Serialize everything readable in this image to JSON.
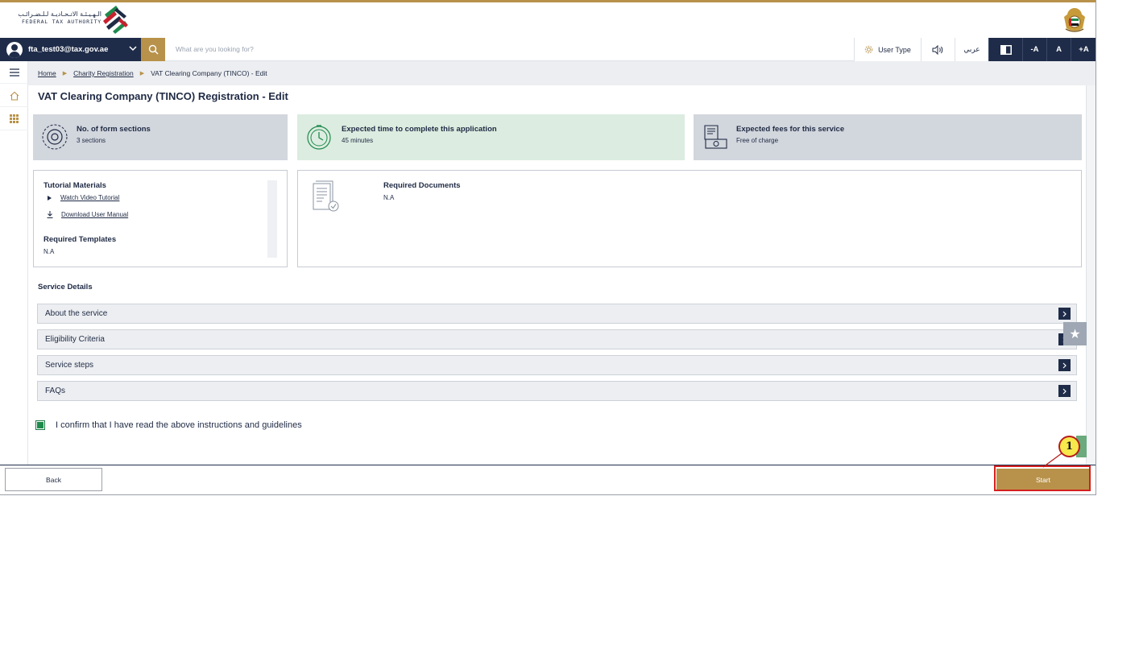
{
  "header": {
    "logo_ar": "الـهـيـئـة الاتـحـاديـة لـلـضـرائـب",
    "logo_en": "FEDERAL TAX AUTHORITY"
  },
  "navbar": {
    "user_email": "fta_test03@tax.gov.ae",
    "search_placeholder": "What are you looking for?",
    "user_type_label": "User Type",
    "arabic_label": "عربي",
    "font_decrease": "-A",
    "font_normal": "A",
    "font_increase": "+A"
  },
  "breadcrumb": {
    "home": "Home",
    "charity": "Charity Registration",
    "current": "VAT Clearing Company (TINCO) - Edit"
  },
  "page_title": "VAT Clearing Company (TINCO) Registration - Edit",
  "cards": {
    "sections": {
      "title": "No. of form sections",
      "value": "3 sections"
    },
    "time": {
      "title": "Expected time to complete this application",
      "value": "45 minutes"
    },
    "fees": {
      "title": "Expected fees for this service",
      "value": "Free of charge"
    }
  },
  "tutorial": {
    "title": "Tutorial Materials",
    "video_link": "Watch Video Tutorial",
    "manual_link": "Download User Manual",
    "templates_title": "Required Templates",
    "templates_value": "N.A"
  },
  "documents": {
    "title": "Required Documents",
    "value": "N.A"
  },
  "service_details": {
    "title": "Service Details",
    "items": [
      "About the service",
      "Eligibility Criteria",
      "Service steps",
      "FAQs"
    ]
  },
  "confirm": {
    "label": "I confirm that I have read the above instructions and guidelines",
    "checked": true
  },
  "footer": {
    "back_label": "Back",
    "start_label": "Start"
  },
  "annotation": {
    "callout_number": "1"
  },
  "colors": {
    "navy": "#1f2c49",
    "gold": "#b8924a",
    "card_grey": "#d2d6dd",
    "card_green": "#dcece0",
    "highlight_red": "#d41f1f",
    "callout_yellow": "#f7e84c"
  }
}
